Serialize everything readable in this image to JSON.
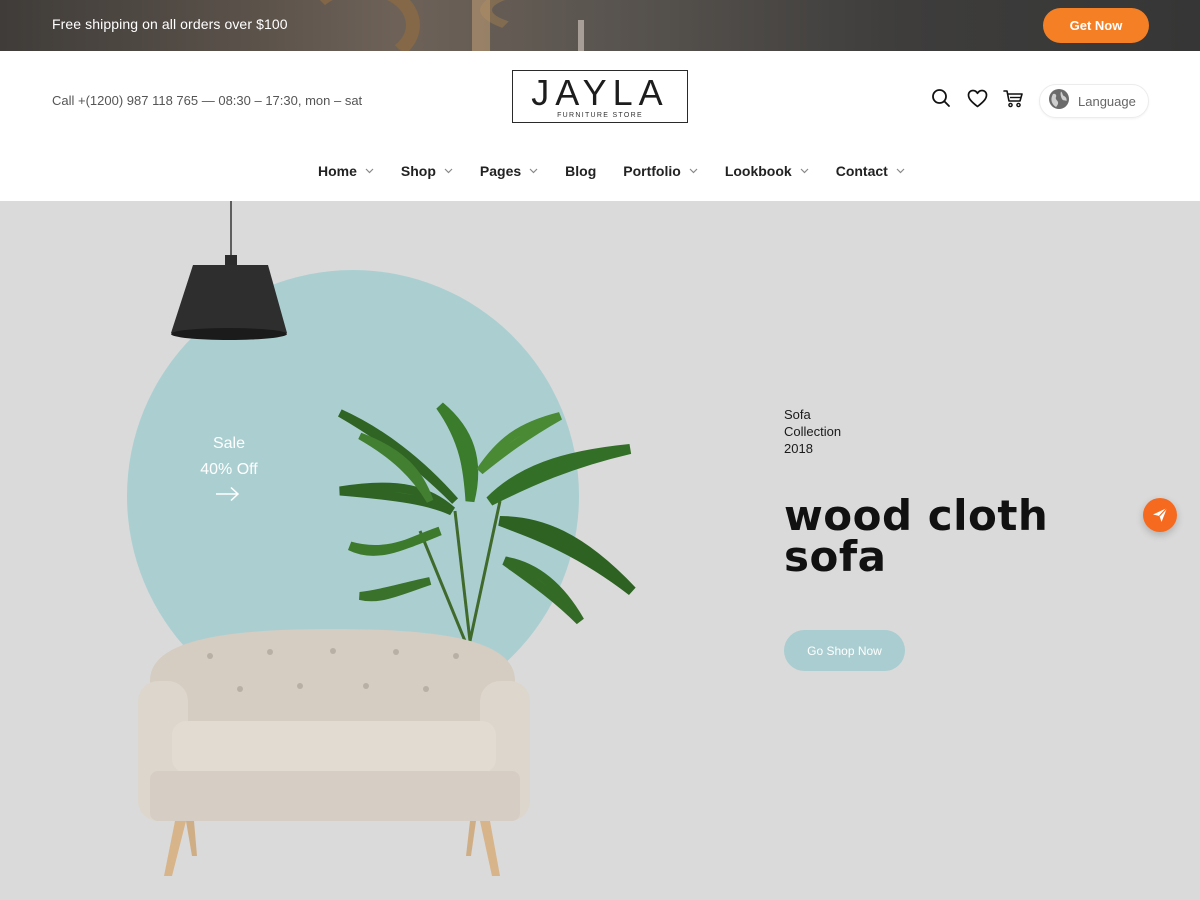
{
  "promo": {
    "text": "Free shipping on all orders over $100",
    "cta_label": "Get Now"
  },
  "header": {
    "contact": "Call +(1200) 987 118 765 — 08:30 – 17:30, mon – sat",
    "logo": {
      "name": "JAYLA",
      "subtitle": "FURNITURE STORE"
    },
    "icons": [
      "search-icon",
      "heart-icon",
      "cart-icon"
    ],
    "language_label": "Language"
  },
  "nav": {
    "items": [
      {
        "label": "Home",
        "has_dropdown": true
      },
      {
        "label": "Shop",
        "has_dropdown": true
      },
      {
        "label": "Pages",
        "has_dropdown": true
      },
      {
        "label": "Blog",
        "has_dropdown": false
      },
      {
        "label": "Portfolio",
        "has_dropdown": true
      },
      {
        "label": "Lookbook",
        "has_dropdown": true
      },
      {
        "label": "Contact",
        "has_dropdown": true
      }
    ]
  },
  "hero": {
    "sale_line1": "Sale",
    "sale_line2": "40% Off",
    "tagline": [
      "Sofa",
      "Collection",
      "2018"
    ],
    "title_line1": "wood cloth",
    "title_line2": "sofa",
    "cta_label": "Go Shop Now"
  },
  "colors": {
    "accent": "#f57f24",
    "circle": "#abcfd1",
    "hero_bg": "#dadada"
  }
}
